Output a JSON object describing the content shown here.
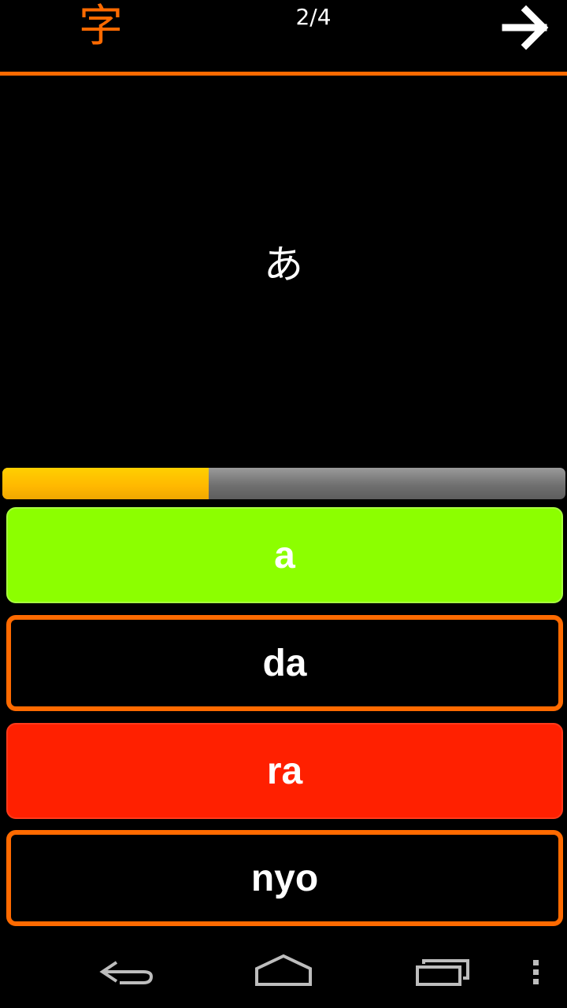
{
  "header": {
    "logo_glyph": "字",
    "counter": "2/4",
    "next_icon": "arrow-right-icon"
  },
  "question": {
    "kana": "あ"
  },
  "progress": {
    "fraction": 0.366
  },
  "answers": [
    {
      "label": "a",
      "state": "correct"
    },
    {
      "label": "da",
      "state": "default"
    },
    {
      "label": "ra",
      "state": "wrong"
    },
    {
      "label": "nyo",
      "state": "default"
    }
  ],
  "colors": {
    "accent": "#ff6a00",
    "correct": "#8cff00",
    "wrong": "#ff2000",
    "progress_fill": "#ffc400",
    "background": "#000000"
  },
  "system_nav": {
    "back_icon": "back-icon",
    "home_icon": "home-icon",
    "recents_icon": "recent-apps-icon",
    "menu_icon": "overflow-menu-icon"
  }
}
